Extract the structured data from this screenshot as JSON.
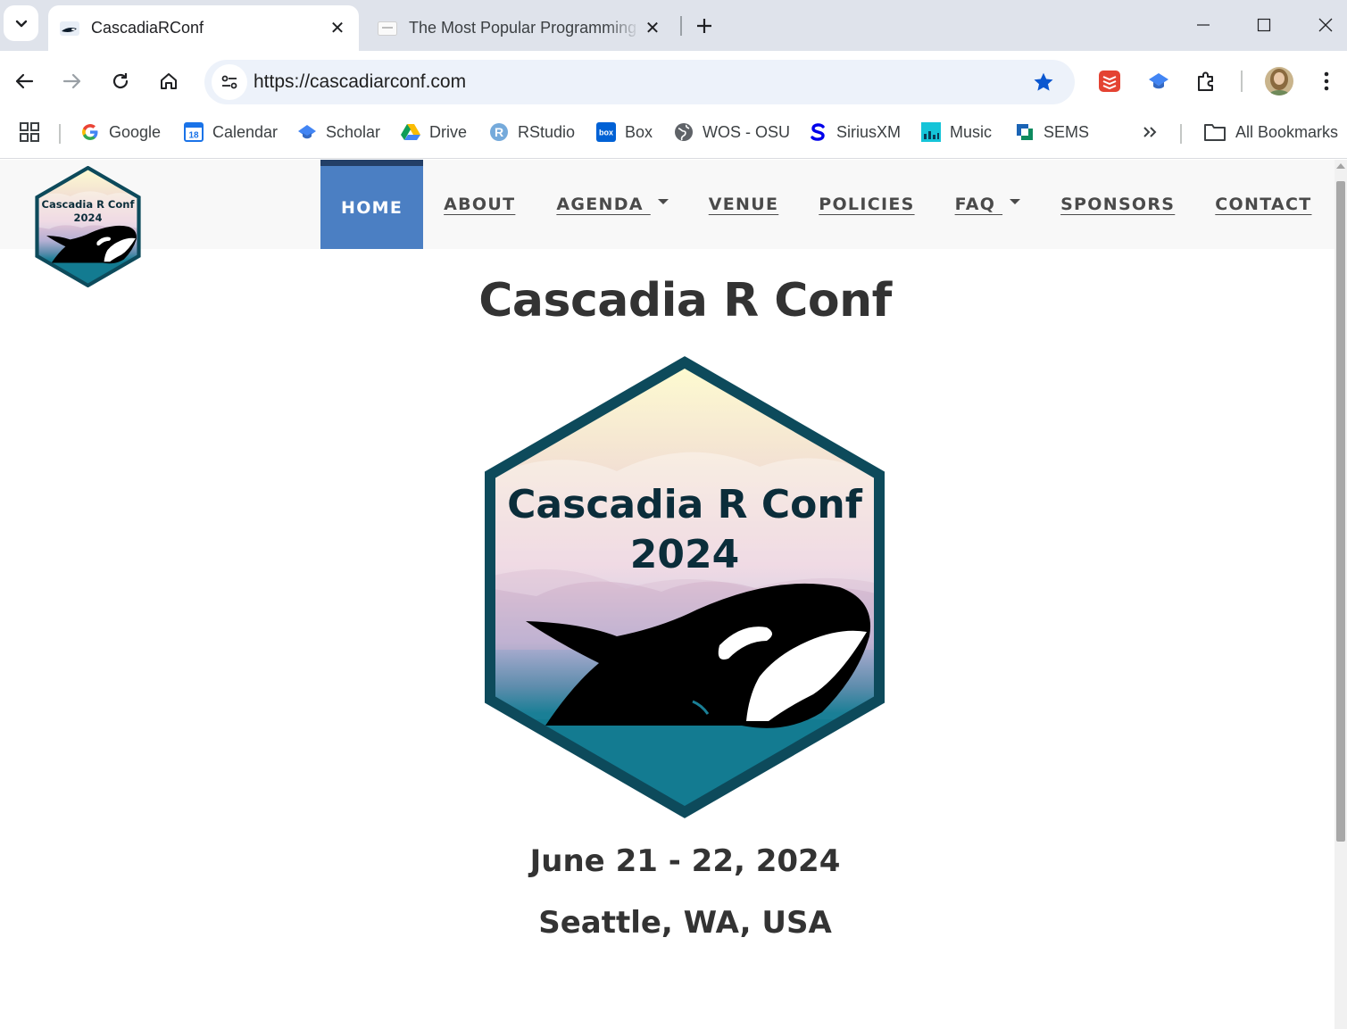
{
  "browser": {
    "tabs": [
      {
        "title": "CascadiaRConf",
        "active": true
      },
      {
        "title": "The Most Popular Programming Languages",
        "active": false
      }
    ],
    "url": "https://cascadiarconf.com",
    "bookmarked": true,
    "bookmarks": [
      {
        "label": "Google",
        "icon": "google-icon"
      },
      {
        "label": "Calendar",
        "icon": "calendar-icon"
      },
      {
        "label": "Scholar",
        "icon": "scholar-icon"
      },
      {
        "label": "Drive",
        "icon": "drive-icon"
      },
      {
        "label": "RStudio",
        "icon": "rstudio-icon"
      },
      {
        "label": "Box",
        "icon": "box-icon"
      },
      {
        "label": "WOS - OSU",
        "icon": "globe-icon"
      },
      {
        "label": "SiriusXM",
        "icon": "siriusxm-icon"
      },
      {
        "label": "Music",
        "icon": "music-icon"
      },
      {
        "label": "SEMS",
        "icon": "sems-icon"
      }
    ],
    "all_bookmarks_label": "All Bookmarks",
    "calendar_day": "18",
    "box_label": "box"
  },
  "site": {
    "nav": [
      {
        "label": "HOME",
        "active": true,
        "dropdown": false
      },
      {
        "label": "ABOUT",
        "active": false,
        "dropdown": false
      },
      {
        "label": "AGENDA ",
        "active": false,
        "dropdown": true
      },
      {
        "label": "VENUE",
        "active": false,
        "dropdown": false
      },
      {
        "label": "POLICIES",
        "active": false,
        "dropdown": false
      },
      {
        "label": "FAQ ",
        "active": false,
        "dropdown": true
      },
      {
        "label": "SPONSORS",
        "active": false,
        "dropdown": false
      },
      {
        "label": "CONTACT",
        "active": false,
        "dropdown": false
      }
    ],
    "logo_text_line1": "Cascadia R Conf",
    "logo_text_line2": "2024",
    "colors": {
      "nav_active": "#4b7fc3",
      "nav_active_top": "#233f67",
      "hex_border": "#0d4a5b",
      "ocean": "#1a7f96"
    }
  },
  "hero": {
    "title": "Cascadia R Conf",
    "date": "June 21 - 22, 2024",
    "location": "Seattle, WA, USA"
  }
}
